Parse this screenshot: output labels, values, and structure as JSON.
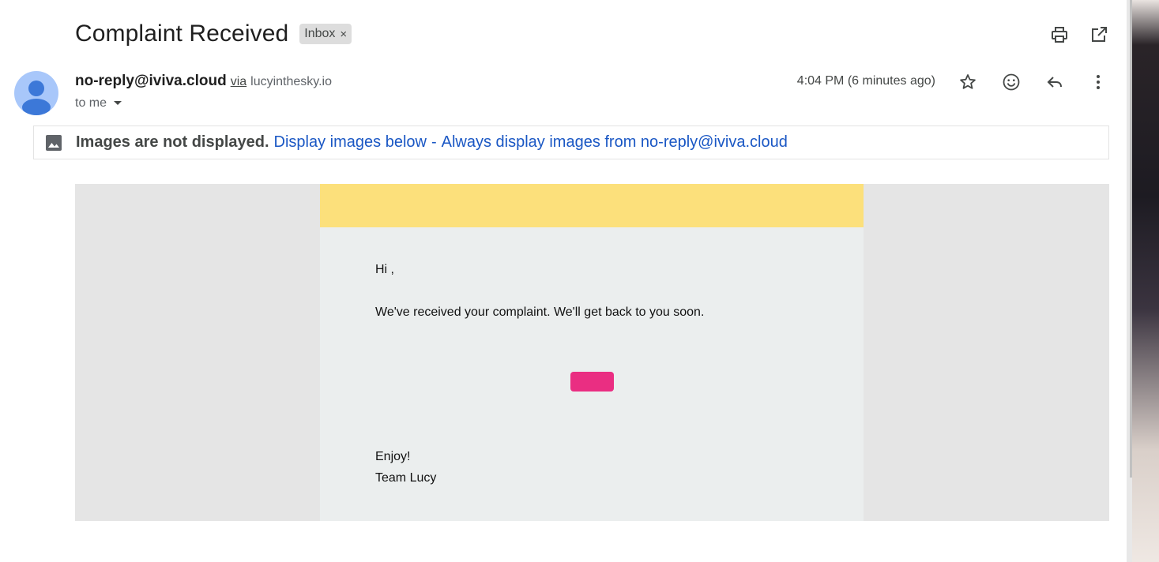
{
  "email": {
    "subject": "Complaint Received",
    "label": "Inbox",
    "label_remove": "×",
    "sender_name": "no-reply@iviva.cloud",
    "via": "via",
    "via_domain": "lucyinthesky.io",
    "recipient": "to me",
    "timestamp": "4:04 PM (6 minutes ago)"
  },
  "icons": {
    "print": "print-icon",
    "open_new": "open-in-new-window-icon",
    "star": "star-icon",
    "emoji": "emoji-reaction-icon",
    "reply": "reply-icon",
    "more": "more-vertical-icon",
    "image": "image-icon",
    "dropdown": "caret-down-icon"
  },
  "banner": {
    "notice": "Images are not displayed.",
    "display_below": "Display images below",
    "separator": "-",
    "always_display": "Always display images from no-reply@iviva.cloud"
  },
  "body": {
    "greeting": "Hi ,",
    "message": "We've received your complaint. We'll get back to you soon.",
    "signoff": "Enjoy!",
    "signature": "Team Lucy"
  },
  "colors": {
    "header_bar": "#fce07b",
    "card_bg": "#ebeeee",
    "canvas_bg": "#e5e5e5",
    "cta_button": "#ea2e82",
    "link": "#1a57c4"
  }
}
